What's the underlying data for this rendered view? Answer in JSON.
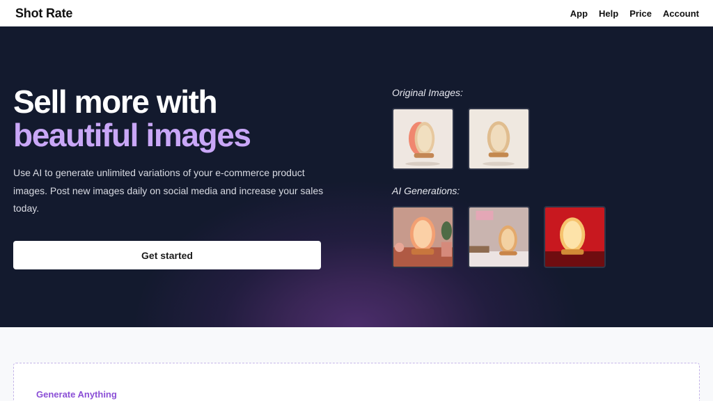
{
  "nav": {
    "brand": "Shot Rate",
    "links": [
      "App",
      "Help",
      "Price",
      "Account"
    ]
  },
  "hero": {
    "headline_line1": "Sell more with",
    "headline_line2": "beautiful images",
    "description": "Use AI to generate unlimited variations of your e-commerce product images. Post new images daily on social media and increase your sales today.",
    "cta_label": "Get started"
  },
  "gallery": {
    "original_label": "Original Images:",
    "ai_label": "AI Generations:"
  },
  "feature": {
    "eyebrow": "Generate Anything"
  },
  "colors": {
    "hero_bg": "#131a2e",
    "accent_purple": "#c9a7f7",
    "eyebrow_purple": "#8b4fd6"
  }
}
